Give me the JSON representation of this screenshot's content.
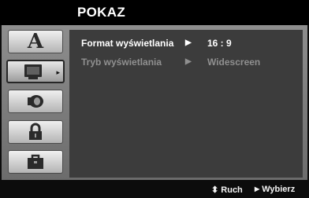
{
  "menu": {
    "title": "POKAZ"
  },
  "sidebar": {
    "tabs": [
      {
        "name": "language-tab",
        "icon": "letter-a-icon",
        "selected": false
      },
      {
        "name": "display-tab",
        "icon": "monitor-icon",
        "selected": true,
        "arrow": "▸"
      },
      {
        "name": "audio-tab",
        "icon": "speaker-icon",
        "selected": false
      },
      {
        "name": "lock-tab",
        "icon": "padlock-icon",
        "selected": false
      },
      {
        "name": "others-tab",
        "icon": "briefcase-icon",
        "selected": false
      }
    ]
  },
  "settings": [
    {
      "label": "Format wyświetlania",
      "arrow": "▶",
      "value": "16 : 9",
      "active": true
    },
    {
      "label": "Tryb wyświetlania",
      "arrow": "▶",
      "value": "Widescreen",
      "active": false
    }
  ],
  "footer": {
    "move_icon": "up-down-arrows-icon",
    "move_glyph": "⬍",
    "move_label": "Ruch",
    "select_glyph": "▶",
    "select_label": "Wybierz"
  },
  "colors": {
    "background": "#0c0c0c",
    "panel": "#3c3c3c",
    "frame": "#7a7a7a",
    "active_text": "#ffffff",
    "inactive_text": "#909090"
  }
}
